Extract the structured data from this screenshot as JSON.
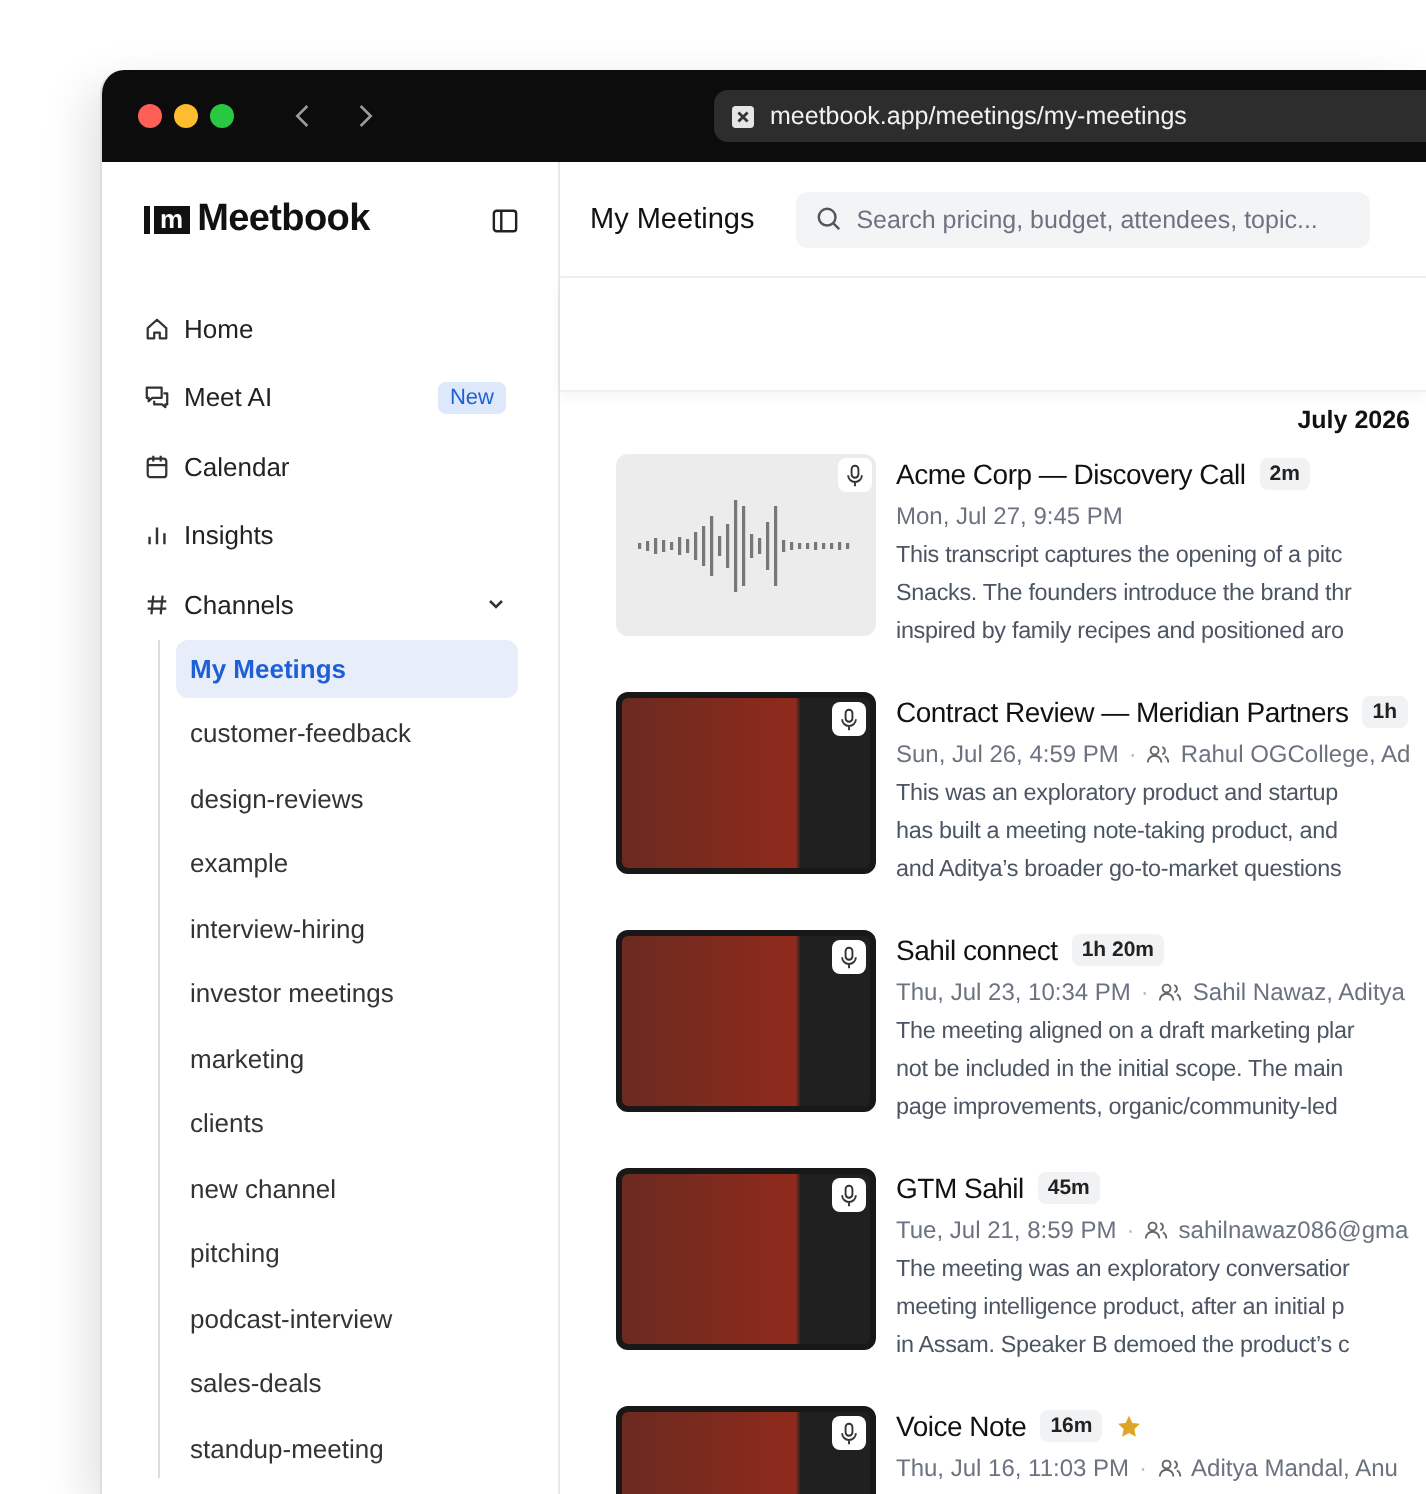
{
  "browser": {
    "url": "meetbook.app/meetings/my-meetings"
  },
  "sidebar": {
    "logo": {
      "mark": "m",
      "name": "Meetbook"
    },
    "nav": [
      {
        "label": "Home",
        "selected": false
      },
      {
        "label": "Meet AI",
        "badge": "New",
        "selected": false
      },
      {
        "label": "Calendar",
        "selected": false
      },
      {
        "label": "Insights",
        "selected": false
      },
      {
        "label": "Channels",
        "expanded": true,
        "selected": false,
        "children": [
          {
            "label": "My Meetings",
            "selected": true
          },
          {
            "label": "customer-feedback",
            "selected": false
          },
          {
            "label": "design-reviews",
            "selected": false
          },
          {
            "label": "example",
            "selected": false
          },
          {
            "label": "interview-hiring",
            "selected": false
          },
          {
            "label": "investor meetings",
            "selected": false
          },
          {
            "label": "marketing",
            "selected": false
          },
          {
            "label": "clients",
            "selected": false
          },
          {
            "label": "new channel",
            "selected": false
          },
          {
            "label": "pitching",
            "selected": false
          },
          {
            "label": "podcast-interview",
            "selected": false
          },
          {
            "label": "sales-deals",
            "selected": false
          },
          {
            "label": "standup-meeting",
            "selected": false
          }
        ]
      }
    ]
  },
  "header": {
    "title": "My Meetings",
    "search": {
      "placeholder": "Search pricing, budget, attendees, topic..."
    }
  },
  "month": "July 2026",
  "meetings": [
    {
      "kind": "audio",
      "title": "Acme Corp — Discovery Call",
      "duration": "2m",
      "starred": false,
      "date": "Mon, Jul 27, 9:45 PM",
      "summary_lines": [
        "This transcript captures the opening of a pitc",
        "Snacks. The founders introduce the brand thr",
        "inspired by family recipes and positioned aro"
      ]
    },
    {
      "kind": "video",
      "title": "Contract Review — Meridian Partners",
      "duration": "1h",
      "starred": false,
      "date": "Sun, Jul 26, 4:59 PM",
      "separator": "·",
      "attendees": "Rahul OGCollege, Ad",
      "summary_lines": [
        "This was an exploratory product and startup",
        "has built a meeting note-taking product, and",
        "and Aditya’s broader go-to-market questions"
      ]
    },
    {
      "kind": "video",
      "title": "Sahil connect",
      "duration": "1h 20m",
      "starred": false,
      "date": "Thu, Jul 23, 10:34 PM",
      "separator": "·",
      "attendees": "Sahil Nawaz, Aditya",
      "summary_lines": [
        "The meeting aligned on a draft marketing plar",
        "not be included in the initial scope. The main",
        "page improvements, organic/community-led"
      ]
    },
    {
      "kind": "video",
      "title": "GTM Sahil",
      "duration": "45m",
      "starred": false,
      "date": "Tue, Jul 21, 8:59 PM",
      "separator": "·",
      "attendees": "sahilnawaz086@gma",
      "summary_lines": [
        "The meeting was an exploratory conversatior",
        "meeting intelligence product, after an initial p",
        "in Assam. Speaker B demoed the product’s c"
      ]
    },
    {
      "kind": "video",
      "title": "Voice Note",
      "duration": "16m",
      "starred": true,
      "date": "Thu, Jul 16, 11:03 PM",
      "separator": "·",
      "attendees": "Aditya Mandal, Anu"
    }
  ]
}
